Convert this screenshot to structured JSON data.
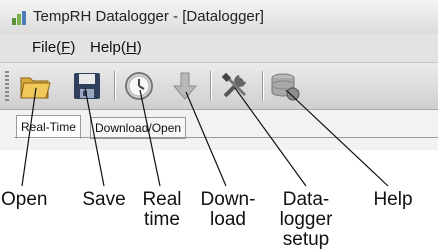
{
  "window": {
    "title": "TempRH Datalogger - [Datalogger]",
    "app_icon": "datalogger-app-icon"
  },
  "menu": [
    {
      "label": "File(F)",
      "underline": "F"
    },
    {
      "label": "Help(H)",
      "underline": "H"
    }
  ],
  "toolbar": {
    "buttons": [
      {
        "name": "open",
        "icon": "folder-icon"
      },
      {
        "name": "save",
        "icon": "floppy-disk-icon"
      },
      {
        "name": "realtime",
        "icon": "clock-icon"
      },
      {
        "name": "download",
        "icon": "down-arrow-icon"
      },
      {
        "name": "setup",
        "icon": "tools-icon"
      },
      {
        "name": "help",
        "icon": "database-help-icon"
      }
    ]
  },
  "tabs": [
    {
      "label": "Real-Time",
      "active": true
    },
    {
      "label": "Download/Open",
      "active": false
    }
  ],
  "callouts": [
    {
      "lines": [
        "Open"
      ]
    },
    {
      "lines": [
        "Save"
      ]
    },
    {
      "lines": [
        "Real",
        "time"
      ]
    },
    {
      "lines": [
        "Down-",
        "load"
      ]
    },
    {
      "lines": [
        "Data-",
        "logger",
        "setup"
      ]
    },
    {
      "lines": [
        "Help"
      ]
    }
  ]
}
